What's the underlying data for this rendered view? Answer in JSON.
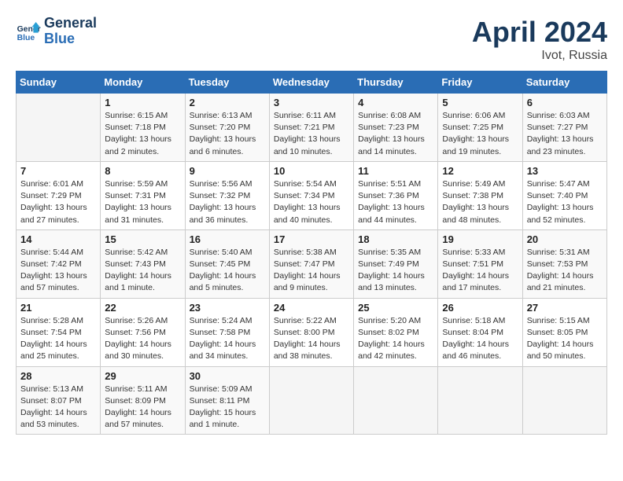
{
  "header": {
    "logo_line1": "General",
    "logo_line2": "Blue",
    "title": "April 2024",
    "subtitle": "Ivot, Russia"
  },
  "weekdays": [
    "Sunday",
    "Monday",
    "Tuesday",
    "Wednesday",
    "Thursday",
    "Friday",
    "Saturday"
  ],
  "weeks": [
    [
      {
        "day": "",
        "info": ""
      },
      {
        "day": "1",
        "info": "Sunrise: 6:15 AM\nSunset: 7:18 PM\nDaylight: 13 hours\nand 2 minutes."
      },
      {
        "day": "2",
        "info": "Sunrise: 6:13 AM\nSunset: 7:20 PM\nDaylight: 13 hours\nand 6 minutes."
      },
      {
        "day": "3",
        "info": "Sunrise: 6:11 AM\nSunset: 7:21 PM\nDaylight: 13 hours\nand 10 minutes."
      },
      {
        "day": "4",
        "info": "Sunrise: 6:08 AM\nSunset: 7:23 PM\nDaylight: 13 hours\nand 14 minutes."
      },
      {
        "day": "5",
        "info": "Sunrise: 6:06 AM\nSunset: 7:25 PM\nDaylight: 13 hours\nand 19 minutes."
      },
      {
        "day": "6",
        "info": "Sunrise: 6:03 AM\nSunset: 7:27 PM\nDaylight: 13 hours\nand 23 minutes."
      }
    ],
    [
      {
        "day": "7",
        "info": "Sunrise: 6:01 AM\nSunset: 7:29 PM\nDaylight: 13 hours\nand 27 minutes."
      },
      {
        "day": "8",
        "info": "Sunrise: 5:59 AM\nSunset: 7:31 PM\nDaylight: 13 hours\nand 31 minutes."
      },
      {
        "day": "9",
        "info": "Sunrise: 5:56 AM\nSunset: 7:32 PM\nDaylight: 13 hours\nand 36 minutes."
      },
      {
        "day": "10",
        "info": "Sunrise: 5:54 AM\nSunset: 7:34 PM\nDaylight: 13 hours\nand 40 minutes."
      },
      {
        "day": "11",
        "info": "Sunrise: 5:51 AM\nSunset: 7:36 PM\nDaylight: 13 hours\nand 44 minutes."
      },
      {
        "day": "12",
        "info": "Sunrise: 5:49 AM\nSunset: 7:38 PM\nDaylight: 13 hours\nand 48 minutes."
      },
      {
        "day": "13",
        "info": "Sunrise: 5:47 AM\nSunset: 7:40 PM\nDaylight: 13 hours\nand 52 minutes."
      }
    ],
    [
      {
        "day": "14",
        "info": "Sunrise: 5:44 AM\nSunset: 7:42 PM\nDaylight: 13 hours\nand 57 minutes."
      },
      {
        "day": "15",
        "info": "Sunrise: 5:42 AM\nSunset: 7:43 PM\nDaylight: 14 hours\nand 1 minute."
      },
      {
        "day": "16",
        "info": "Sunrise: 5:40 AM\nSunset: 7:45 PM\nDaylight: 14 hours\nand 5 minutes."
      },
      {
        "day": "17",
        "info": "Sunrise: 5:38 AM\nSunset: 7:47 PM\nDaylight: 14 hours\nand 9 minutes."
      },
      {
        "day": "18",
        "info": "Sunrise: 5:35 AM\nSunset: 7:49 PM\nDaylight: 14 hours\nand 13 minutes."
      },
      {
        "day": "19",
        "info": "Sunrise: 5:33 AM\nSunset: 7:51 PM\nDaylight: 14 hours\nand 17 minutes."
      },
      {
        "day": "20",
        "info": "Sunrise: 5:31 AM\nSunset: 7:53 PM\nDaylight: 14 hours\nand 21 minutes."
      }
    ],
    [
      {
        "day": "21",
        "info": "Sunrise: 5:28 AM\nSunset: 7:54 PM\nDaylight: 14 hours\nand 25 minutes."
      },
      {
        "day": "22",
        "info": "Sunrise: 5:26 AM\nSunset: 7:56 PM\nDaylight: 14 hours\nand 30 minutes."
      },
      {
        "day": "23",
        "info": "Sunrise: 5:24 AM\nSunset: 7:58 PM\nDaylight: 14 hours\nand 34 minutes."
      },
      {
        "day": "24",
        "info": "Sunrise: 5:22 AM\nSunset: 8:00 PM\nDaylight: 14 hours\nand 38 minutes."
      },
      {
        "day": "25",
        "info": "Sunrise: 5:20 AM\nSunset: 8:02 PM\nDaylight: 14 hours\nand 42 minutes."
      },
      {
        "day": "26",
        "info": "Sunrise: 5:18 AM\nSunset: 8:04 PM\nDaylight: 14 hours\nand 46 minutes."
      },
      {
        "day": "27",
        "info": "Sunrise: 5:15 AM\nSunset: 8:05 PM\nDaylight: 14 hours\nand 50 minutes."
      }
    ],
    [
      {
        "day": "28",
        "info": "Sunrise: 5:13 AM\nSunset: 8:07 PM\nDaylight: 14 hours\nand 53 minutes."
      },
      {
        "day": "29",
        "info": "Sunrise: 5:11 AM\nSunset: 8:09 PM\nDaylight: 14 hours\nand 57 minutes."
      },
      {
        "day": "30",
        "info": "Sunrise: 5:09 AM\nSunset: 8:11 PM\nDaylight: 15 hours\nand 1 minute."
      },
      {
        "day": "",
        "info": ""
      },
      {
        "day": "",
        "info": ""
      },
      {
        "day": "",
        "info": ""
      },
      {
        "day": "",
        "info": ""
      }
    ]
  ]
}
